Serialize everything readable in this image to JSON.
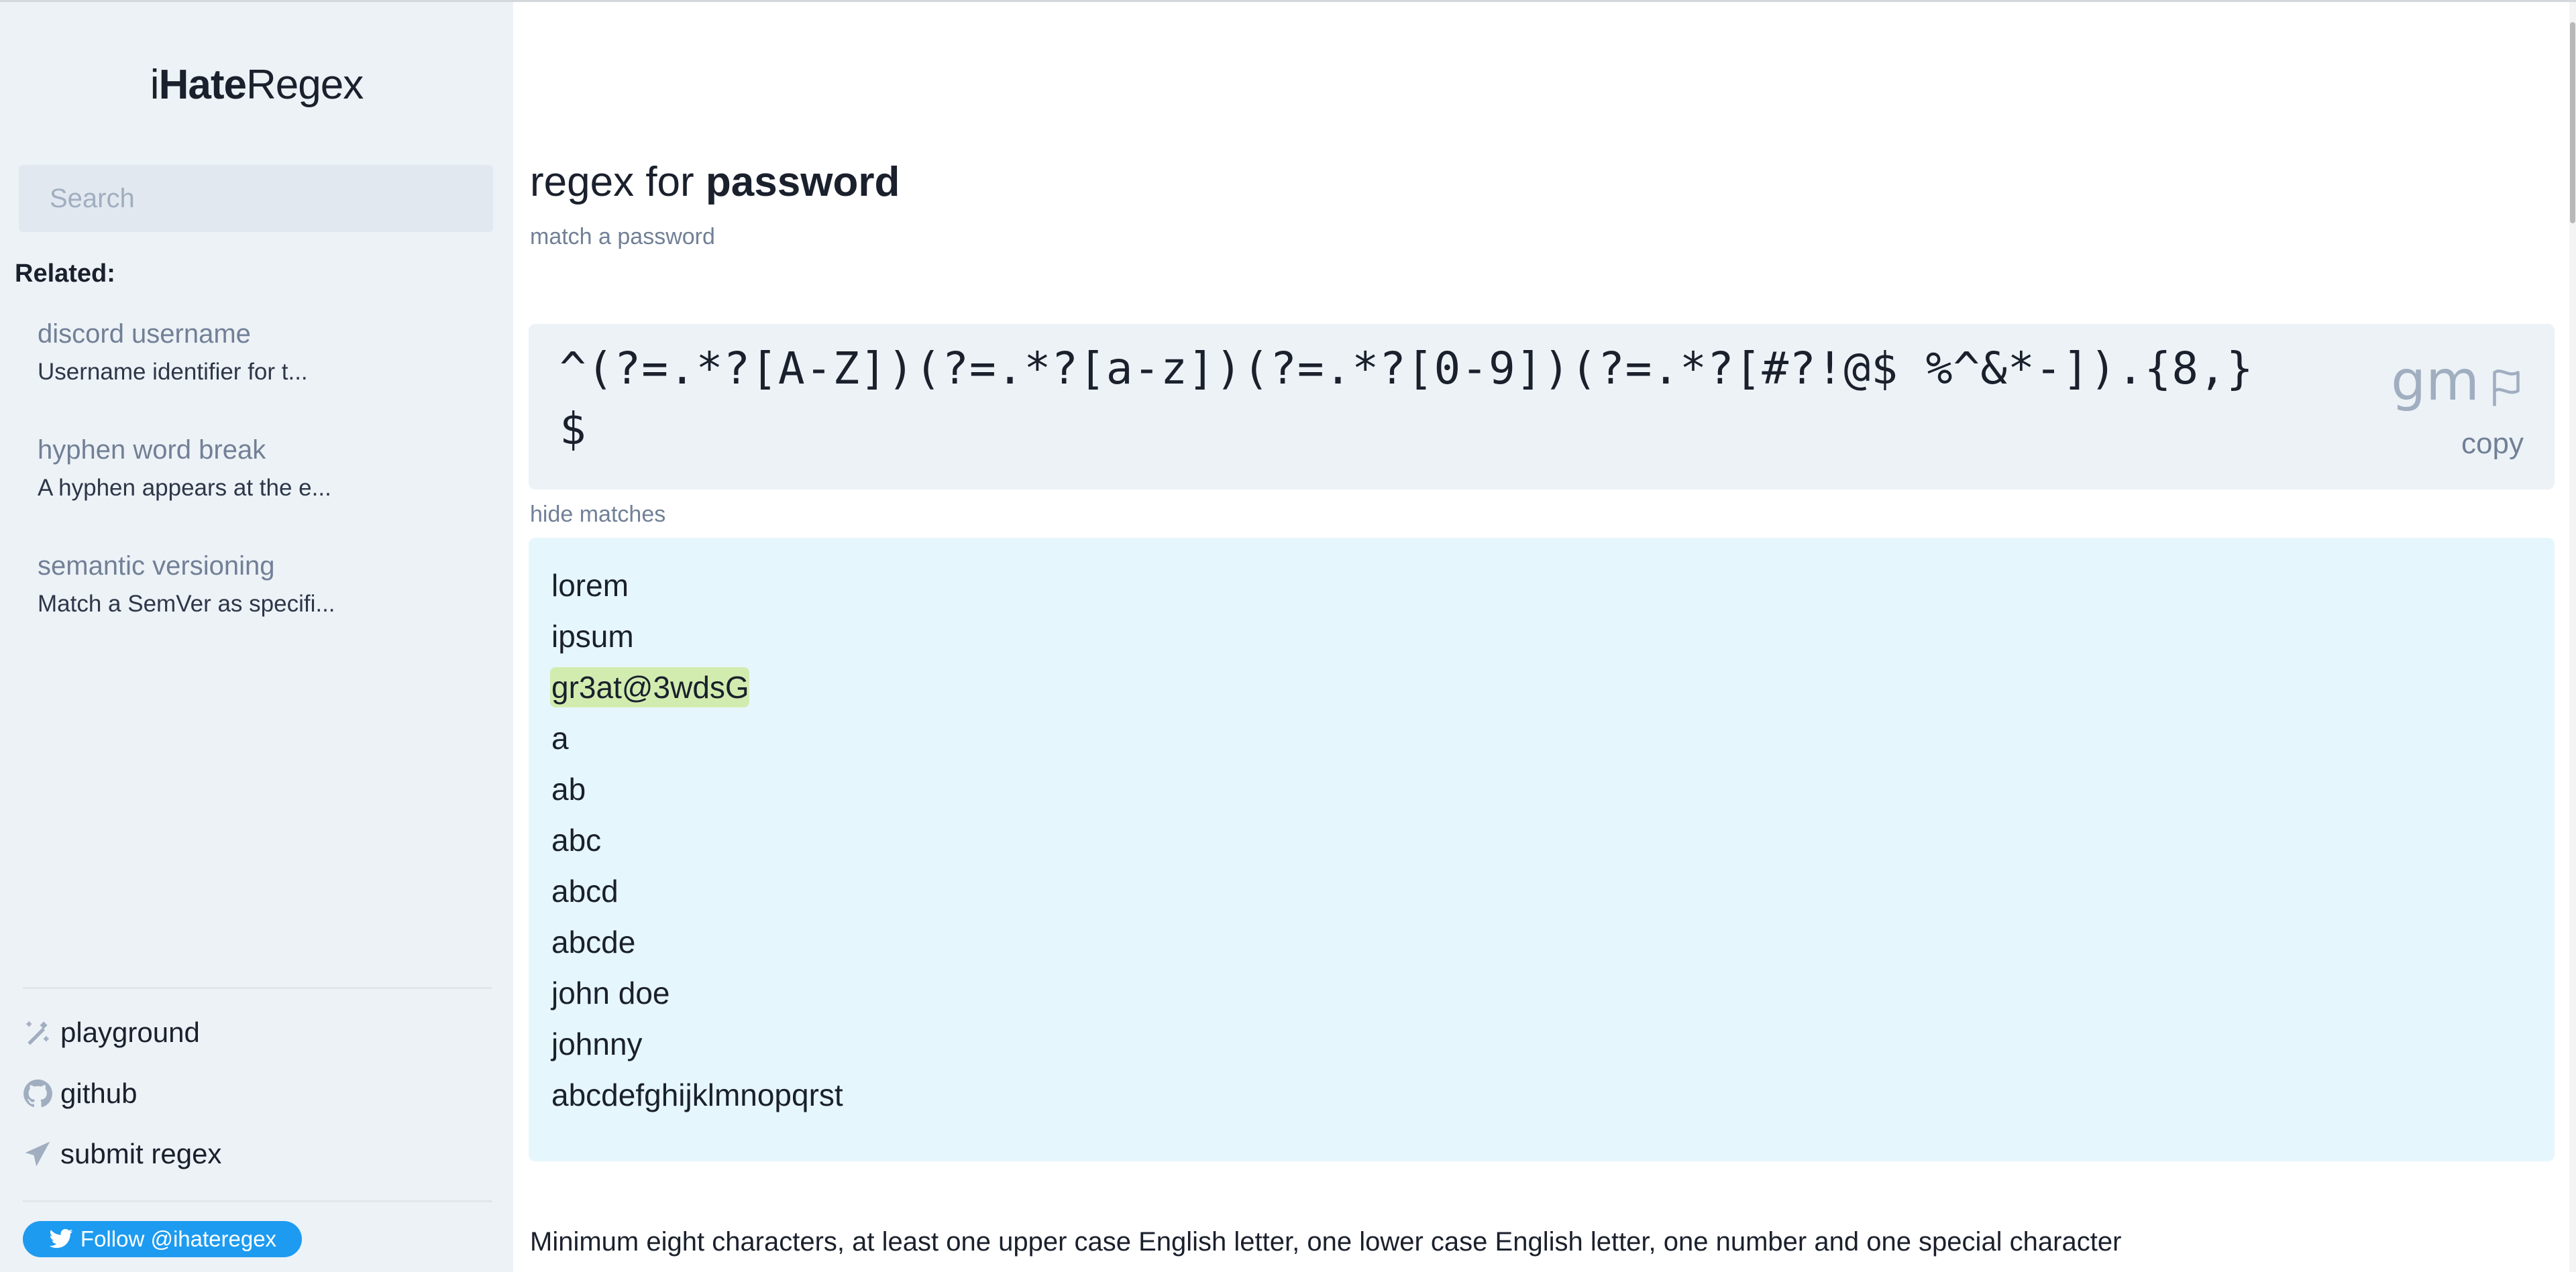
{
  "logo": {
    "prefix": "i",
    "bold": "Hate",
    "suffix": "Regex"
  },
  "search": {
    "placeholder": "Search",
    "value": ""
  },
  "sidebar": {
    "related_label": "Related:",
    "related": [
      {
        "title": "discord username",
        "description": "Username identifier for t..."
      },
      {
        "title": "hyphen word break",
        "description": "A hyphen appears at the e..."
      },
      {
        "title": "semantic versioning",
        "description": "Match a SemVer as specifi..."
      }
    ],
    "links": [
      {
        "label": "playground",
        "icon": "magic-wand-icon"
      },
      {
        "label": "github",
        "icon": "github-icon"
      },
      {
        "label": "submit regex",
        "icon": "paper-plane-icon"
      }
    ],
    "twitter_button": "Follow @ihateregex"
  },
  "header": {
    "title_prefix": "regex for ",
    "title_bold": "password",
    "subtitle": "match a password"
  },
  "regex": {
    "pattern": "^(?=.*?[A-Z])(?=.*?[a-z])(?=.*?[0-9])(?=.*?[#?!@$ %^&*-]).{8,}$",
    "flags": "gm",
    "flag_icon": "flag-icon",
    "copy_label": "copy"
  },
  "matches": {
    "toggle_label": "hide matches",
    "lines": [
      {
        "text": "lorem",
        "match": false
      },
      {
        "text": "ipsum",
        "match": false
      },
      {
        "text": "gr3at@3wdsG",
        "match": true
      },
      {
        "text": "a",
        "match": false
      },
      {
        "text": "ab",
        "match": false
      },
      {
        "text": "abc",
        "match": false
      },
      {
        "text": "abcd",
        "match": false
      },
      {
        "text": "abcde",
        "match": false
      },
      {
        "text": "john doe",
        "match": false
      },
      {
        "text": "johnny",
        "match": false
      },
      {
        "text": "abcdefghijklmnopqrst",
        "match": false
      }
    ],
    "highlight_color": "#d2ecb0"
  },
  "description": "Minimum eight characters, at least one upper case English letter, one lower case English letter, one number and one special character"
}
